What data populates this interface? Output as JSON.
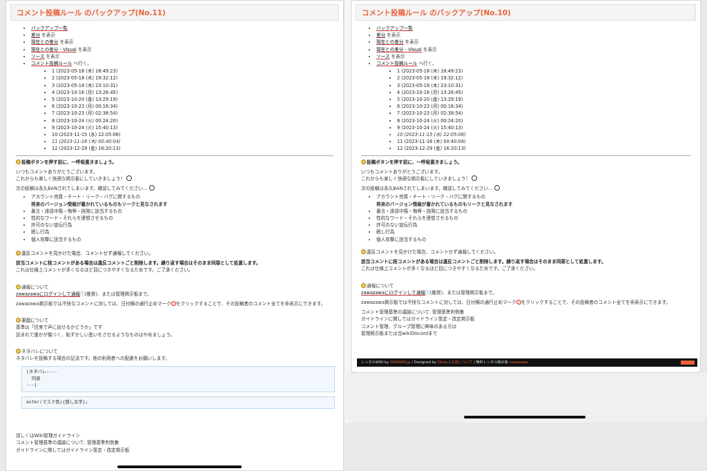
{
  "left": {
    "title": "コメント投稿ルール のバックアップ(No.11)",
    "links": [
      {
        "link": "バックアップ一覧",
        "rest": ""
      },
      {
        "link": "差分",
        "rest": " を表示"
      },
      {
        "link": "現在との差分",
        "rest": " を表示"
      },
      {
        "link": "現在との差分 - Visual",
        "rest": " を表示"
      },
      {
        "link": "ソース",
        "rest": " を表示"
      },
      {
        "link": "コメント投稿ルール",
        "rest": " へ行く。"
      }
    ],
    "backups": [
      "1 (2023-05-18 (木) 18:49:23)",
      "2 (2023-05-18 (木) 19:32:12)",
      "3 (2023-05-18 (木) 23:10:31)",
      "4 (2023-10-16 (月) 13:26:45)",
      "5 (2023-10-20 (金) 13:29:19)",
      "6 (2023-10-23 (月) 00:16:34)",
      "7 (2023-10-23 (月) 02:38:54)",
      "8 (2023-10-24 (火) 00:24:20)",
      "9 (2023-10-24 (火) 15:40:13)",
      "10 (2023-11-15 (水) 22:05:06)",
      "11 (2023-11-16 (木) 00:40:04)",
      "12 (2023-12-29 (金) 16:20:13)"
    ],
    "current_index": 10,
    "extra_sections": {
      "netabare_head": "ネタバレについて",
      "netabare_text": "ネタバレを投稿する場合の記法です。他の利用者への配慮をお願いします。",
      "code1": "[ネタバレ:---\n  内容\n---]",
      "code2": "&ntbr(マスク色){隠し文字};",
      "more1": "詳しくはWiki管理ガイドライン",
      "more2": "コメント管理基準の議論について: 管理基準判例集",
      "more3": "ガイドラインに関してはガイドライン策定・改定掲示板"
    }
  },
  "right": {
    "title": "コメント投稿ルール のバックアップ(No.10)",
    "links": [
      {
        "link": "バックアップ一覧",
        "rest": ""
      },
      {
        "link": "差分",
        "rest": " を表示"
      },
      {
        "link": "現在との差分",
        "rest": " を表示"
      },
      {
        "link": "現在との差分 - Visual",
        "rest": " を表示"
      },
      {
        "link": "ソース",
        "rest": " を表示"
      },
      {
        "link": "コメント投稿ルール",
        "rest": " へ行く。"
      }
    ],
    "backups": [
      "1 (2023-05-18 (木) 18:49:23)",
      "2 (2023-05-18 (木) 19:32:12)",
      "3 (2023-05-18 (木) 23:10:31)",
      "4 (2023-10-16 (月) 13:26:45)",
      "5 (2023-10-20 (金) 13:29:19)",
      "6 (2023-10-23 (月) 00:16:34)",
      "7 (2023-10-23 (月) 02:38:54)",
      "8 (2023-10-24 (火) 00:24:20)",
      "9 (2023-10-24 (火) 15:40:13)",
      "10 (2023-11-15 (水) 22:05:06)",
      "11 (2023-11-16 (木) 00:40:04)",
      "12 (2023-12-29 (金) 16:20:13)"
    ],
    "current_index": 9,
    "tail": {
      "l1": "コメント管理基準の議論について: 管理基準判例集",
      "l2": "ガイドラインに関してはガイドライン策定・改定掲示板",
      "l3": "コメント管理、グループ管理に興味のある方は",
      "l4": "管理掲示板または当wikiDiscordまで"
    },
    "footer": {
      "text1": "レンタルWIKI by ",
      "link1": "WIKIWIKI.jp",
      "text2": " / Designed by ",
      "link2": "Olivia",
      "text3": " / ",
      "link3": "広告について",
      "text4": " / 無料レンタル掲示板 ",
      "link4": "zawazawa"
    }
  },
  "common": {
    "s1_head": "投稿ボタンを押す前に、一呼吸置きましょう。",
    "s1_p1": "いつもコメントありがとうございます。",
    "s1_p2": "これからも楽しく快適な掲示板にしていきましょう！",
    "s1_p3": "次の投稿は永久BANされてしまいます。確認してみてください…",
    "rules": [
      "アカウント売買・チート・リーク・バグに関するもの",
      "将来のバージョン情報が書かれているものもリークと見なされます",
      "暴言・誹謗中傷・侮辱・挑発に該当するもの",
      "性的なワード・それらを連想させるもの",
      "許可のない宣伝行為",
      "晒し行為",
      "個人攻撃に該当するもの"
    ],
    "s2_head": "違反コメントを見かけた場合、コメントせず通報してください。",
    "s2_bold": "該当コメントに枝コメントがある場合は違反コメントごと削除します。繰り返す場合はそのまま同罪として処置します。",
    "s2_p": "これは仕様上コメントが多くなるほど目につきやすくなるためです。ご了承ください。",
    "s3_head": "通報について",
    "s3_p1": "zawazawaにログインして通報",
    "s3_p1b": "(推奨)、または管理掲示板まで。",
    "s3_p2": "zawazawa掲示板では不快なコメントに対しては、日付横の通行止めマーク",
    "s3_p2b": "をクリックすることで、その投稿者のコメント全てを非表示にできます。",
    "s4_head": "悪戯について",
    "s4_p1": "基準は「往来で声に出せるかどうか」です",
    "s4_p2": "読まれて誰かが傷つく、恥ずかしい思いをさせるようなものはやめましょう。"
  }
}
